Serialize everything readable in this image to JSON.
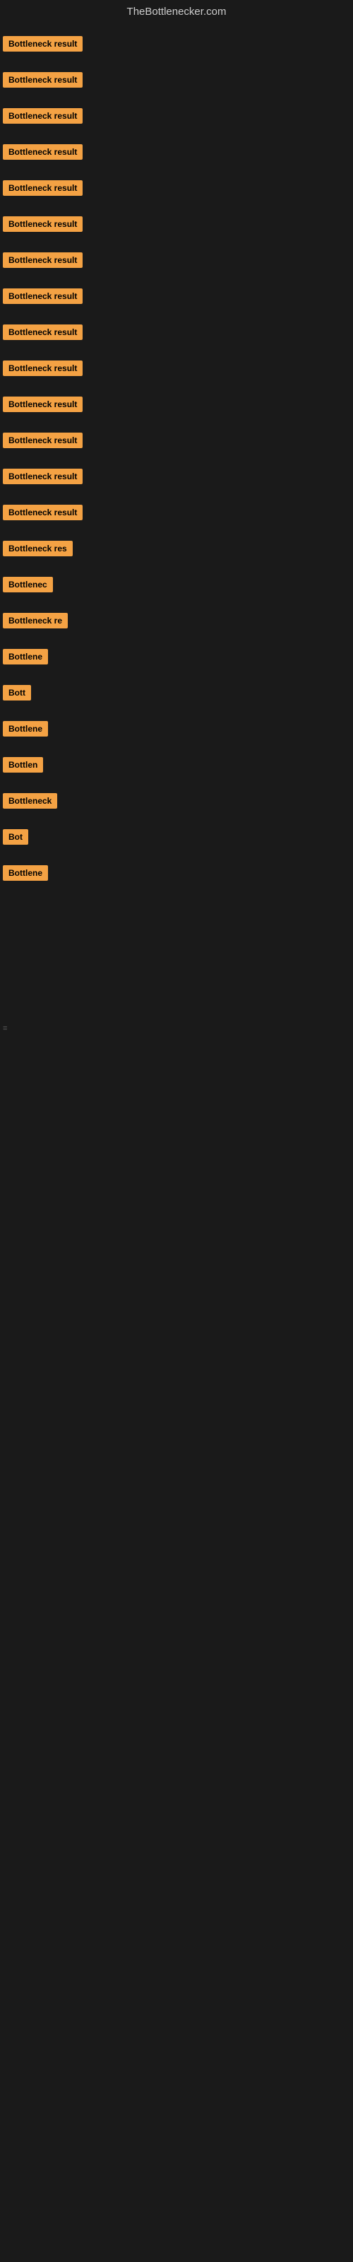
{
  "header": {
    "title": "TheBottlenecker.com"
  },
  "rows": [
    {
      "id": 1,
      "label": "Bottleneck result",
      "class": "row-1"
    },
    {
      "id": 2,
      "label": "Bottleneck result",
      "class": "row-2"
    },
    {
      "id": 3,
      "label": "Bottleneck result",
      "class": "row-3"
    },
    {
      "id": 4,
      "label": "Bottleneck result",
      "class": "row-4"
    },
    {
      "id": 5,
      "label": "Bottleneck result",
      "class": "row-5"
    },
    {
      "id": 6,
      "label": "Bottleneck result",
      "class": "row-6"
    },
    {
      "id": 7,
      "label": "Bottleneck result",
      "class": "row-7"
    },
    {
      "id": 8,
      "label": "Bottleneck result",
      "class": "row-8"
    },
    {
      "id": 9,
      "label": "Bottleneck result",
      "class": "row-9"
    },
    {
      "id": 10,
      "label": "Bottleneck result",
      "class": "row-10"
    },
    {
      "id": 11,
      "label": "Bottleneck result",
      "class": "row-11"
    },
    {
      "id": 12,
      "label": "Bottleneck result",
      "class": "row-12"
    },
    {
      "id": 13,
      "label": "Bottleneck result",
      "class": "row-13"
    },
    {
      "id": 14,
      "label": "Bottleneck result",
      "class": "row-14"
    },
    {
      "id": 15,
      "label": "Bottleneck res",
      "class": "row-15"
    },
    {
      "id": 16,
      "label": "Bottlenec",
      "class": "row-16"
    },
    {
      "id": 17,
      "label": "Bottleneck re",
      "class": "row-17"
    },
    {
      "id": 18,
      "label": "Bottlene",
      "class": "row-18"
    },
    {
      "id": 19,
      "label": "Bott",
      "class": "row-19"
    },
    {
      "id": 20,
      "label": "Bottlene",
      "class": "row-20"
    },
    {
      "id": 21,
      "label": "Bottlen",
      "class": "row-21"
    },
    {
      "id": 22,
      "label": "Bottleneck",
      "class": "row-22"
    },
    {
      "id": 23,
      "label": "Bot",
      "class": "row-23"
    },
    {
      "id": 24,
      "label": "Bottlene",
      "class": "row-24"
    }
  ],
  "footer_indicator": "≡"
}
